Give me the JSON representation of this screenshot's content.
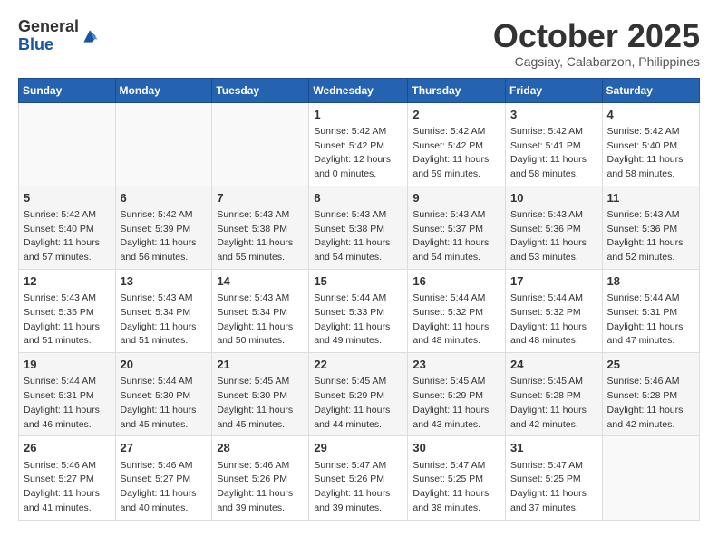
{
  "logo": {
    "general": "General",
    "blue": "Blue"
  },
  "title": "October 2025",
  "subtitle": "Cagsiay, Calabarzon, Philippines",
  "days_of_week": [
    "Sunday",
    "Monday",
    "Tuesday",
    "Wednesday",
    "Thursday",
    "Friday",
    "Saturday"
  ],
  "weeks": [
    [
      {
        "day": "",
        "info": ""
      },
      {
        "day": "",
        "info": ""
      },
      {
        "day": "",
        "info": ""
      },
      {
        "day": "1",
        "info": "Sunrise: 5:42 AM\nSunset: 5:42 PM\nDaylight: 12 hours\nand 0 minutes."
      },
      {
        "day": "2",
        "info": "Sunrise: 5:42 AM\nSunset: 5:42 PM\nDaylight: 11 hours\nand 59 minutes."
      },
      {
        "day": "3",
        "info": "Sunrise: 5:42 AM\nSunset: 5:41 PM\nDaylight: 11 hours\nand 58 minutes."
      },
      {
        "day": "4",
        "info": "Sunrise: 5:42 AM\nSunset: 5:40 PM\nDaylight: 11 hours\nand 58 minutes."
      }
    ],
    [
      {
        "day": "5",
        "info": "Sunrise: 5:42 AM\nSunset: 5:40 PM\nDaylight: 11 hours\nand 57 minutes."
      },
      {
        "day": "6",
        "info": "Sunrise: 5:42 AM\nSunset: 5:39 PM\nDaylight: 11 hours\nand 56 minutes."
      },
      {
        "day": "7",
        "info": "Sunrise: 5:43 AM\nSunset: 5:38 PM\nDaylight: 11 hours\nand 55 minutes."
      },
      {
        "day": "8",
        "info": "Sunrise: 5:43 AM\nSunset: 5:38 PM\nDaylight: 11 hours\nand 54 minutes."
      },
      {
        "day": "9",
        "info": "Sunrise: 5:43 AM\nSunset: 5:37 PM\nDaylight: 11 hours\nand 54 minutes."
      },
      {
        "day": "10",
        "info": "Sunrise: 5:43 AM\nSunset: 5:36 PM\nDaylight: 11 hours\nand 53 minutes."
      },
      {
        "day": "11",
        "info": "Sunrise: 5:43 AM\nSunset: 5:36 PM\nDaylight: 11 hours\nand 52 minutes."
      }
    ],
    [
      {
        "day": "12",
        "info": "Sunrise: 5:43 AM\nSunset: 5:35 PM\nDaylight: 11 hours\nand 51 minutes."
      },
      {
        "day": "13",
        "info": "Sunrise: 5:43 AM\nSunset: 5:34 PM\nDaylight: 11 hours\nand 51 minutes."
      },
      {
        "day": "14",
        "info": "Sunrise: 5:43 AM\nSunset: 5:34 PM\nDaylight: 11 hours\nand 50 minutes."
      },
      {
        "day": "15",
        "info": "Sunrise: 5:44 AM\nSunset: 5:33 PM\nDaylight: 11 hours\nand 49 minutes."
      },
      {
        "day": "16",
        "info": "Sunrise: 5:44 AM\nSunset: 5:32 PM\nDaylight: 11 hours\nand 48 minutes."
      },
      {
        "day": "17",
        "info": "Sunrise: 5:44 AM\nSunset: 5:32 PM\nDaylight: 11 hours\nand 48 minutes."
      },
      {
        "day": "18",
        "info": "Sunrise: 5:44 AM\nSunset: 5:31 PM\nDaylight: 11 hours\nand 47 minutes."
      }
    ],
    [
      {
        "day": "19",
        "info": "Sunrise: 5:44 AM\nSunset: 5:31 PM\nDaylight: 11 hours\nand 46 minutes."
      },
      {
        "day": "20",
        "info": "Sunrise: 5:44 AM\nSunset: 5:30 PM\nDaylight: 11 hours\nand 45 minutes."
      },
      {
        "day": "21",
        "info": "Sunrise: 5:45 AM\nSunset: 5:30 PM\nDaylight: 11 hours\nand 45 minutes."
      },
      {
        "day": "22",
        "info": "Sunrise: 5:45 AM\nSunset: 5:29 PM\nDaylight: 11 hours\nand 44 minutes."
      },
      {
        "day": "23",
        "info": "Sunrise: 5:45 AM\nSunset: 5:29 PM\nDaylight: 11 hours\nand 43 minutes."
      },
      {
        "day": "24",
        "info": "Sunrise: 5:45 AM\nSunset: 5:28 PM\nDaylight: 11 hours\nand 42 minutes."
      },
      {
        "day": "25",
        "info": "Sunrise: 5:46 AM\nSunset: 5:28 PM\nDaylight: 11 hours\nand 42 minutes."
      }
    ],
    [
      {
        "day": "26",
        "info": "Sunrise: 5:46 AM\nSunset: 5:27 PM\nDaylight: 11 hours\nand 41 minutes."
      },
      {
        "day": "27",
        "info": "Sunrise: 5:46 AM\nSunset: 5:27 PM\nDaylight: 11 hours\nand 40 minutes."
      },
      {
        "day": "28",
        "info": "Sunrise: 5:46 AM\nSunset: 5:26 PM\nDaylight: 11 hours\nand 39 minutes."
      },
      {
        "day": "29",
        "info": "Sunrise: 5:47 AM\nSunset: 5:26 PM\nDaylight: 11 hours\nand 39 minutes."
      },
      {
        "day": "30",
        "info": "Sunrise: 5:47 AM\nSunset: 5:25 PM\nDaylight: 11 hours\nand 38 minutes."
      },
      {
        "day": "31",
        "info": "Sunrise: 5:47 AM\nSunset: 5:25 PM\nDaylight: 11 hours\nand 37 minutes."
      },
      {
        "day": "",
        "info": ""
      }
    ]
  ]
}
